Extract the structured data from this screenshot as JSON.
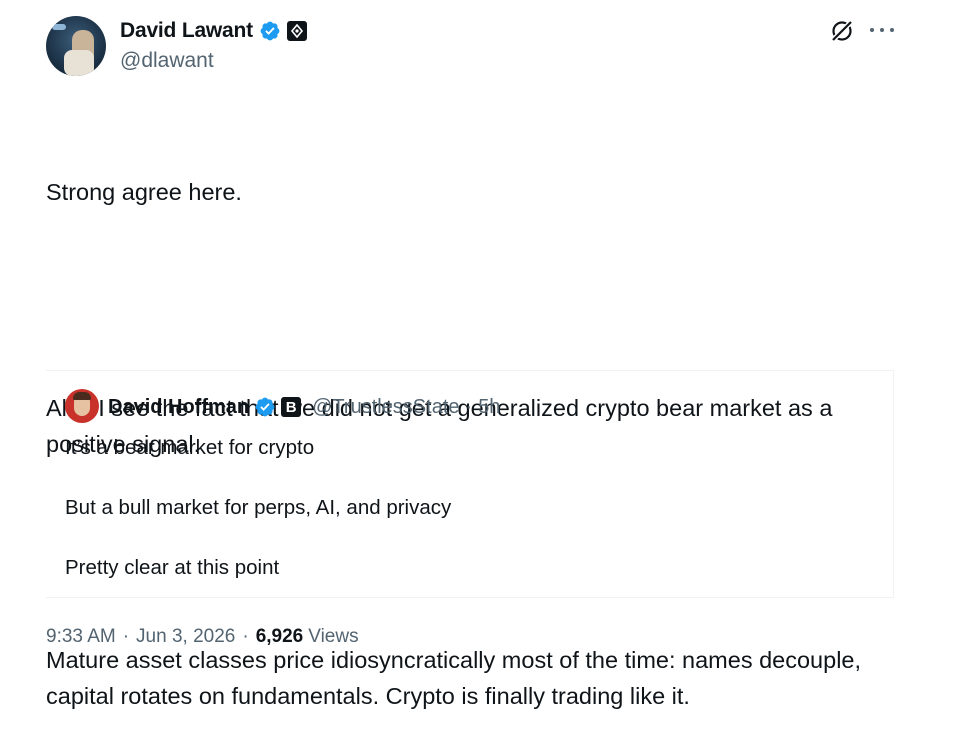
{
  "author": {
    "name": "David Lawant",
    "handle": "@dlawant"
  },
  "tweet": {
    "paragraphs": [
      "Strong agree here.",
      "Also I see the fact that we did not get a generalized crypto bear market as a positive signal.",
      "Mature asset classes price idiosyncratically most of the time: names decouple, capital rotates on fundamentals. Crypto is finally trading like it."
    ]
  },
  "quoted_tweet": {
    "name": "David Hoffman",
    "affiliate_badge": "B",
    "handle": "@TrustlessState",
    "separator": "·",
    "time": "5h",
    "paragraphs": [
      "It’s a bear market for crypto",
      "But a bull market for perps, AI, and privacy",
      "Pretty clear at this point"
    ]
  },
  "footer": {
    "time": "9:33 AM",
    "date": "Jun 3, 2026",
    "separator": "·",
    "views_count": "6,926",
    "views_label": "Views"
  },
  "colors": {
    "verified": "#1d9bf0",
    "secondary_text": "#536471",
    "primary_text": "#0f1419"
  },
  "icons": [
    "verified-badge-icon",
    "affiliate-badge-icon",
    "grok-icon",
    "more-icon"
  ]
}
